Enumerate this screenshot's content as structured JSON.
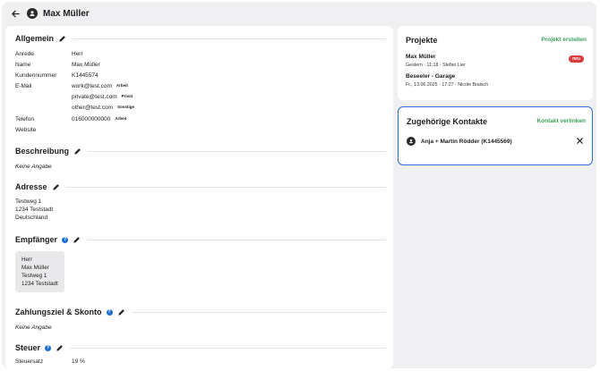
{
  "header": {
    "title": "Max Müller"
  },
  "allgemein": {
    "title": "Allgemein",
    "fields": {
      "anrede": {
        "label": "Anrede",
        "value": "Herr"
      },
      "name": {
        "label": "Name",
        "value": "Max Müller"
      },
      "kundennummer": {
        "label": "Kundennummer",
        "value": "K1445574"
      },
      "email": {
        "label": "E-Mail",
        "entries": [
          {
            "value": "work@test.com",
            "tag": "Arbeit"
          },
          {
            "value": "private@test.com",
            "tag": "Privat"
          },
          {
            "value": "other@test.com",
            "tag": "Sonstige"
          }
        ]
      },
      "telefon": {
        "label": "Telefon",
        "value": "016000000000",
        "tag": "Arbeit"
      },
      "website": {
        "label": "Website",
        "value": ""
      }
    }
  },
  "beschreibung": {
    "title": "Beschreibung",
    "empty": "Keine Angabe"
  },
  "adresse": {
    "title": "Adresse",
    "lines": [
      "Testweg 1",
      "1234 Teststadt",
      "Deutschland"
    ]
  },
  "empfaenger": {
    "title": "Empfänger",
    "lines": [
      "Herr",
      "Max Müller",
      "Testweg 1",
      "1234 Teststadt"
    ]
  },
  "zahlungsziel": {
    "title": "Zahlungsziel & Skonto",
    "empty": "Keine Angabe"
  },
  "steuer": {
    "title": "Steuer",
    "label": "Steuersatz",
    "value": "19 %"
  },
  "projekte": {
    "title": "Projekte",
    "action": "Projekt erstellen",
    "items": [
      {
        "name": "Max Müller",
        "meta": "Gestern · 11:18 · Stefan Lier",
        "badge": "neu"
      },
      {
        "name": "Beseeler - Garage",
        "meta": "Fr., 13.06.2025 · 17:27 · Nicole Braisch"
      }
    ]
  },
  "kontakte": {
    "title": "Zugehörige Kontakte",
    "action": "Kontakt verlinken",
    "items": [
      {
        "name": "Anja + Martin Rödder (K1445569)"
      }
    ]
  },
  "colors": {
    "accent_green": "#3aa25a",
    "badge_red": "#d93a3a",
    "focus_blue": "#2b6ed4",
    "help_blue": "#1f70d6"
  }
}
